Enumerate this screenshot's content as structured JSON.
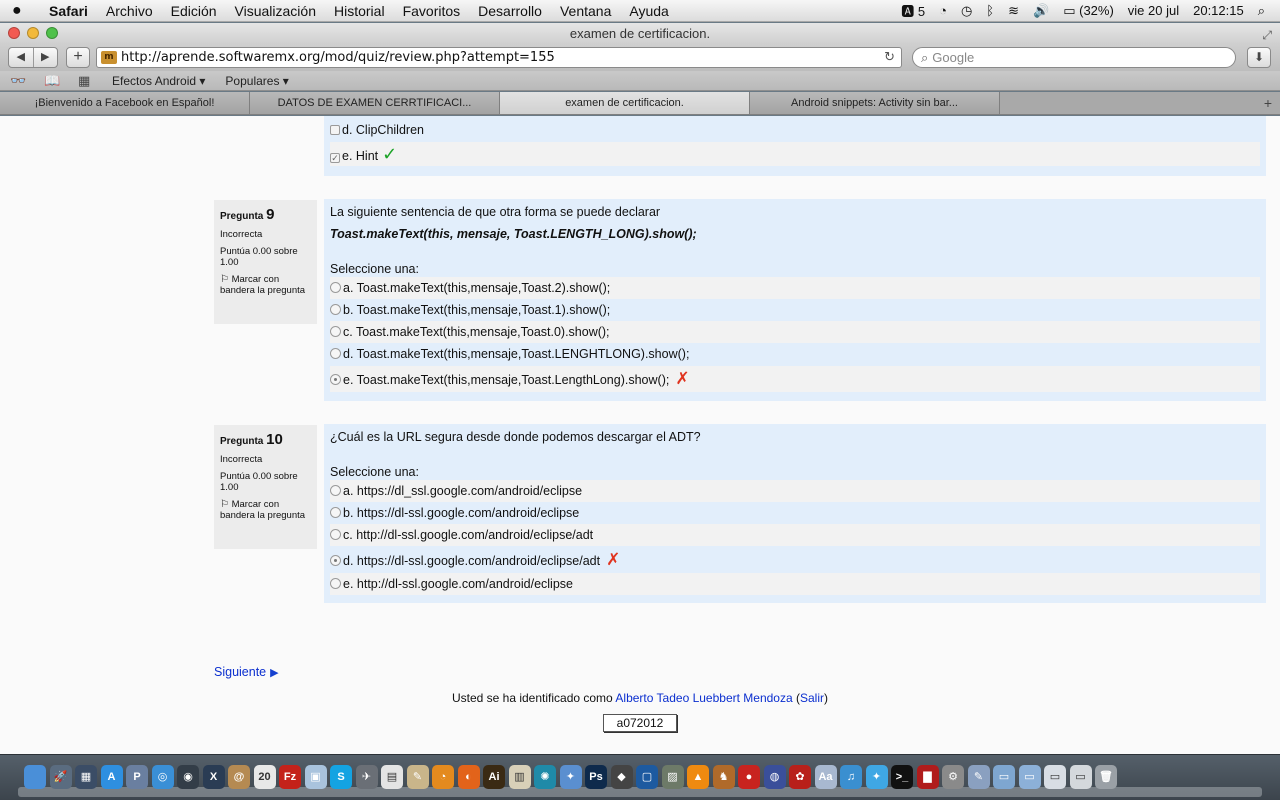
{
  "menubar": {
    "apple": "",
    "items": [
      "Safari",
      "Archivo",
      "Edición",
      "Visualización",
      "Historial",
      "Favoritos",
      "Desarrollo",
      "Ventana",
      "Ayuda"
    ],
    "status": {
      "adobe": "5",
      "battery": "(32%)",
      "date": "vie 20 jul",
      "time": "20:12:15"
    }
  },
  "window": {
    "title": "examen de certificacion."
  },
  "toolbar": {
    "back": "◀",
    "forward": "▶",
    "add": "+",
    "url": "http://aprende.softwaremx.org/mod/quiz/review.php?attempt=155",
    "search_placeholder": "Google"
  },
  "bookmarks": [
    "Efectos Android ▾",
    "Populares ▾"
  ],
  "tabs": [
    "¡Bienvenido a Facebook en Español!",
    "DATOS DE EXAMEN CERRTIFICACI...",
    "examen de certificacion.",
    "Android snippets: Activity sin bar..."
  ],
  "prev_question": {
    "answers": [
      {
        "label": "d. ClipChildren",
        "checked": false
      },
      {
        "label": "e. Hint",
        "checked": true,
        "mark": "✓"
      }
    ]
  },
  "questions": [
    {
      "prefix": "Pregunta",
      "number": "9",
      "state": "Incorrecta",
      "grade": "Puntúa 0.00 sobre 1.00",
      "flag_label": "Marcar con bandera la pregunta",
      "text": "La siguiente sentencia de que otra forma se puede declarar",
      "code": "Toast.makeText(this, mensaje, Toast.LENGTH_LONG).show();",
      "select_label": "Seleccione una:",
      "answers": [
        {
          "label": "a. Toast.makeText(this,mensaje,Toast.2).show();",
          "selected": false
        },
        {
          "label": "b. Toast.makeText(this,mensaje,Toast.1).show();",
          "selected": false
        },
        {
          "label": "c. Toast.makeText(this,mensaje,Toast.0).show();",
          "selected": false
        },
        {
          "label": "d. Toast.makeText(this,mensaje,Toast.LENGHTLONG).show();",
          "selected": false
        },
        {
          "label": "e. Toast.makeText(this,mensaje,Toast.LengthLong).show();",
          "selected": true,
          "mark": "✗"
        }
      ]
    },
    {
      "prefix": "Pregunta",
      "number": "10",
      "state": "Incorrecta",
      "grade": "Puntúa 0.00 sobre 1.00",
      "flag_label": "Marcar con bandera la pregunta",
      "text": "¿Cuál es la URL segura desde donde podemos descargar el ADT?",
      "select_label": "Seleccione una:",
      "answers": [
        {
          "label": "a. https://dl_ssl.google.com/android/eclipse",
          "selected": false
        },
        {
          "label": "b. https://dl-ssl.google.com/android/eclipse",
          "selected": false
        },
        {
          "label": "c. http://dl-ssl.google.com/android/eclipse/adt",
          "selected": false
        },
        {
          "label": "d. https://dl-ssl.google.com/android/eclipse/adt",
          "selected": true,
          "mark": "✗"
        },
        {
          "label": "e. http://dl-ssl.google.com/android/eclipse",
          "selected": false
        }
      ]
    }
  ],
  "footer": {
    "next": "Siguiente",
    "next_arrow": "▶",
    "login_prefix": "Usted se ha identificado como",
    "user": "Alberto Tadeo Luebbert Mendoza",
    "logout": "Salir",
    "code": "a072012"
  },
  "dock": {
    "icons": [
      {
        "name": "finder-icon",
        "color": "#4a8fd8",
        "glyph": ""
      },
      {
        "name": "launchpad-icon",
        "color": "#5a6c80",
        "glyph": "🚀"
      },
      {
        "name": "mission-control-icon",
        "color": "#3b4d66",
        "glyph": "▦"
      },
      {
        "name": "app-store-icon",
        "color": "#2e8fe0",
        "glyph": "A"
      },
      {
        "name": "preview-icon",
        "color": "#6a7fa0",
        "glyph": "P"
      },
      {
        "name": "safari-icon",
        "color": "#3a8fd6",
        "glyph": "◎"
      },
      {
        "name": "camera-icon",
        "color": "#333d48",
        "glyph": "◉"
      },
      {
        "name": "x11-icon",
        "color": "#2a3c54",
        "glyph": "X"
      },
      {
        "name": "address-book-icon",
        "color": "#b58a52",
        "glyph": "@"
      },
      {
        "name": "calendar-icon",
        "color": "#e8e8e8",
        "glyph": "20"
      },
      {
        "name": "filezilla-icon",
        "color": "#c4221a",
        "glyph": "Fz"
      },
      {
        "name": "package-icon",
        "color": "#a9c3dd",
        "glyph": "▣"
      },
      {
        "name": "skype-icon",
        "color": "#14a3e2",
        "glyph": "S"
      },
      {
        "name": "xcode-tools-icon",
        "color": "#6a6f76",
        "glyph": "✈"
      },
      {
        "name": "document-icon",
        "color": "#e4e4e4",
        "glyph": "▤"
      },
      {
        "name": "writing-icon",
        "color": "#c9b58a",
        "glyph": "✎"
      },
      {
        "name": "blender-icon",
        "color": "#e48a1e",
        "glyph": "◔"
      },
      {
        "name": "firefox-icon",
        "color": "#e2631a",
        "glyph": "◐"
      },
      {
        "name": "illustrator-icon",
        "color": "#3a2a14",
        "glyph": "Ai"
      },
      {
        "name": "paper-icon",
        "color": "#d8d0b8",
        "glyph": "▥"
      },
      {
        "name": "globe-icon",
        "color": "#1f8aa8",
        "glyph": "✺"
      },
      {
        "name": "angry-birds-icon",
        "color": "#5a8fd0",
        "glyph": "✦"
      },
      {
        "name": "photoshop-icon",
        "color": "#0e2a4c",
        "glyph": "Ps"
      },
      {
        "name": "unity-icon",
        "color": "#444",
        "glyph": "◆"
      },
      {
        "name": "virtualbox-icon",
        "color": "#1d5aa0",
        "glyph": "▢"
      },
      {
        "name": "photo-icon",
        "color": "#6d7a68",
        "glyph": "▨"
      },
      {
        "name": "vlc-icon",
        "color": "#ef8a10",
        "glyph": "▲"
      },
      {
        "name": "game-icon",
        "color": "#b06a2a",
        "glyph": "♞"
      },
      {
        "name": "angry-birds-red-icon",
        "color": "#c8231f",
        "glyph": "●"
      },
      {
        "name": "network-icon",
        "color": "#3a4f9a",
        "glyph": "◍"
      },
      {
        "name": "plant-icon",
        "color": "#b8201a",
        "glyph": "✿"
      },
      {
        "name": "dictionary-icon",
        "color": "#a8b8d0",
        "glyph": "Aa"
      },
      {
        "name": "itunes-icon",
        "color": "#3a8fd0",
        "glyph": "♫"
      },
      {
        "name": "twitter-icon",
        "color": "#3fa7e4",
        "glyph": "✦"
      },
      {
        "name": "terminal-icon",
        "color": "#111",
        "glyph": ">_"
      },
      {
        "name": "photo-booth-icon",
        "color": "#b01c1c",
        "glyph": "▇"
      },
      {
        "name": "system-preferences-icon",
        "color": "#8a8a8a",
        "glyph": "⚙"
      },
      {
        "name": "script-editor-icon",
        "color": "#8aa0c0",
        "glyph": "✎"
      },
      {
        "name": "applications-folder-icon",
        "color": "#7ea6d0",
        "glyph": "▭"
      },
      {
        "name": "downloads-folder-icon",
        "color": "#8cb0d8",
        "glyph": "▭"
      },
      {
        "name": "documents-folder-icon",
        "color": "#d8dde4",
        "glyph": "▭"
      },
      {
        "name": "stack-folder-icon",
        "color": "#d4d8dc",
        "glyph": "▭"
      },
      {
        "name": "trash-icon",
        "color": "#9aa0a6",
        "glyph": "🗑"
      }
    ]
  }
}
